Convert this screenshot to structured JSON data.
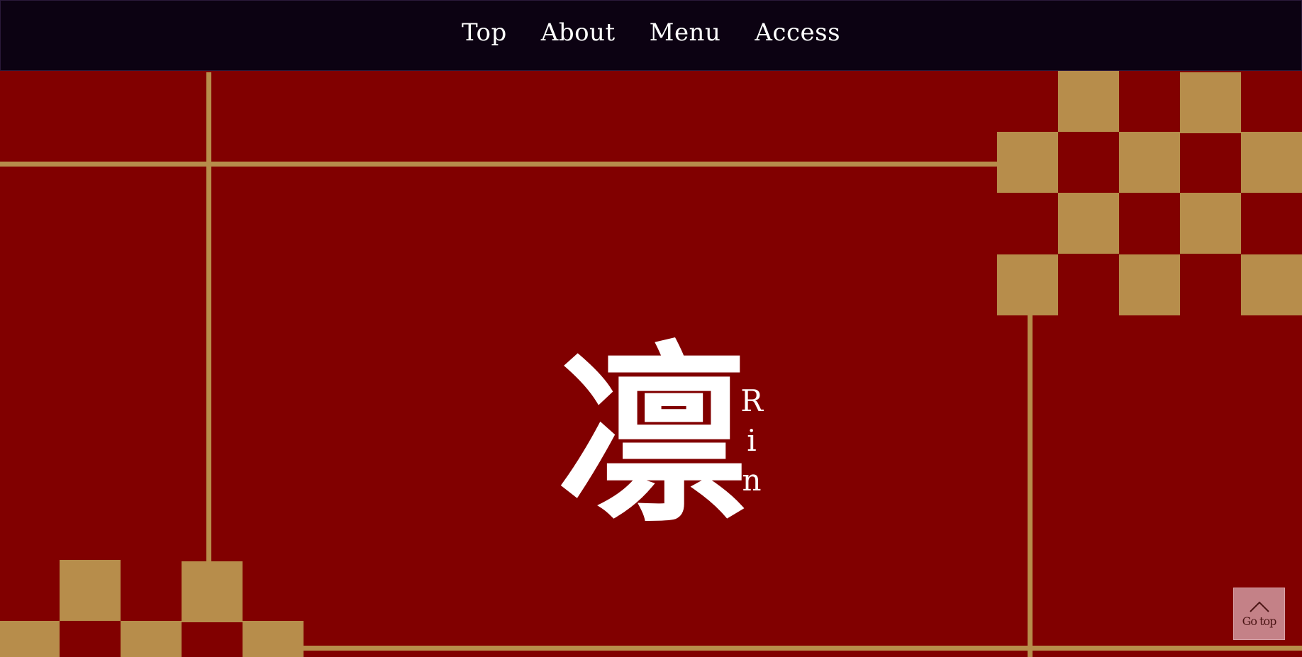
{
  "nav": {
    "items": [
      {
        "label": "Top"
      },
      {
        "label": "About"
      },
      {
        "label": "Menu"
      },
      {
        "label": "Access"
      }
    ]
  },
  "hero": {
    "logo_kanji": "凛",
    "logo_sub": [
      "R",
      "i",
      "n"
    ]
  },
  "gotop": {
    "label": "Go top",
    "icon": "chevron-up-icon"
  },
  "colors": {
    "nav_bg": "#0c0212",
    "hero_bg": "#810000",
    "gold": "#b78d4b",
    "gotop_bg": "#c48187"
  }
}
